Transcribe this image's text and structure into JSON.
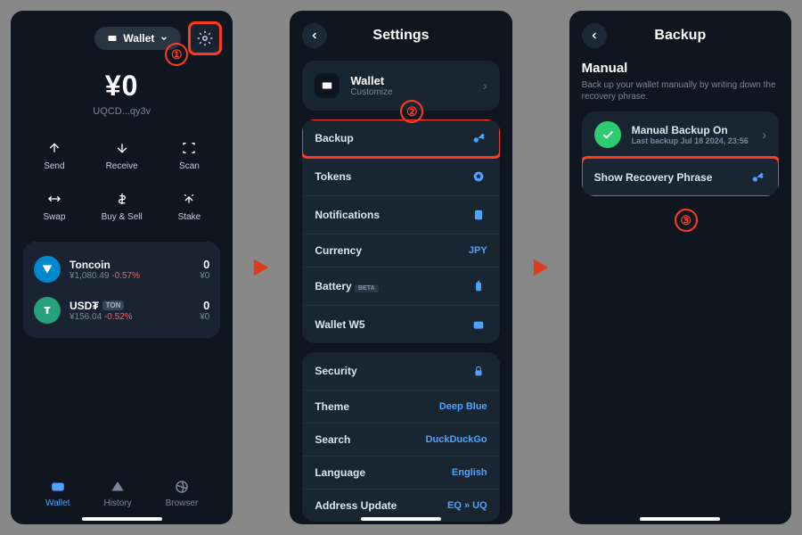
{
  "callouts": {
    "one": "①",
    "two": "②",
    "three": "③"
  },
  "colors": {
    "accent": "#4da3ff",
    "negative": "#ff5c5c",
    "highlight": "#ff3b1f"
  },
  "wallet_screen": {
    "wallet_pill": "Wallet",
    "balance": "¥0",
    "address": "UQCD...qy3v",
    "actions": {
      "send": "Send",
      "receive": "Receive",
      "scan": "Scan",
      "swap": "Swap",
      "buysell": "Buy & Sell",
      "stake": "Stake"
    },
    "tokens": [
      {
        "name": "Toncoin",
        "price": "¥1,080.49",
        "change": "-0.57%",
        "bal": "0",
        "fiat": "¥0"
      },
      {
        "name": "USD₮",
        "badge": "TON",
        "price": "¥156.04",
        "change": "-0.52%",
        "bal": "0",
        "fiat": "¥0"
      }
    ],
    "tabs": {
      "wallet": "Wallet",
      "history": "History",
      "browser": "Browser"
    }
  },
  "settings_screen": {
    "title": "Settings",
    "wallet_card": {
      "title": "Wallet",
      "sub": "Customize"
    },
    "rows_g1": {
      "backup": "Backup",
      "tokens": "Tokens",
      "notifications": "Notifications",
      "currency": {
        "label": "Currency",
        "val": "JPY"
      },
      "battery": {
        "label": "Battery",
        "badge": "BETA"
      },
      "wallet_w5": "Wallet W5"
    },
    "rows_g2": {
      "security": "Security",
      "theme": {
        "label": "Theme",
        "val": "Deep Blue"
      },
      "search": {
        "label": "Search",
        "val": "DuckDuckGo"
      },
      "language": {
        "label": "Language",
        "val": "English"
      },
      "address_update": {
        "label": "Address Update",
        "val": "EQ » UQ"
      }
    }
  },
  "backup_screen": {
    "title": "Backup",
    "manual_title": "Manual",
    "manual_desc": "Back up your wallet manually by writing down the recovery phrase.",
    "status": {
      "title": "Manual Backup On",
      "sub": "Last backup Jul 18 2024, 23:56"
    },
    "show_phrase": "Show Recovery Phrase"
  }
}
